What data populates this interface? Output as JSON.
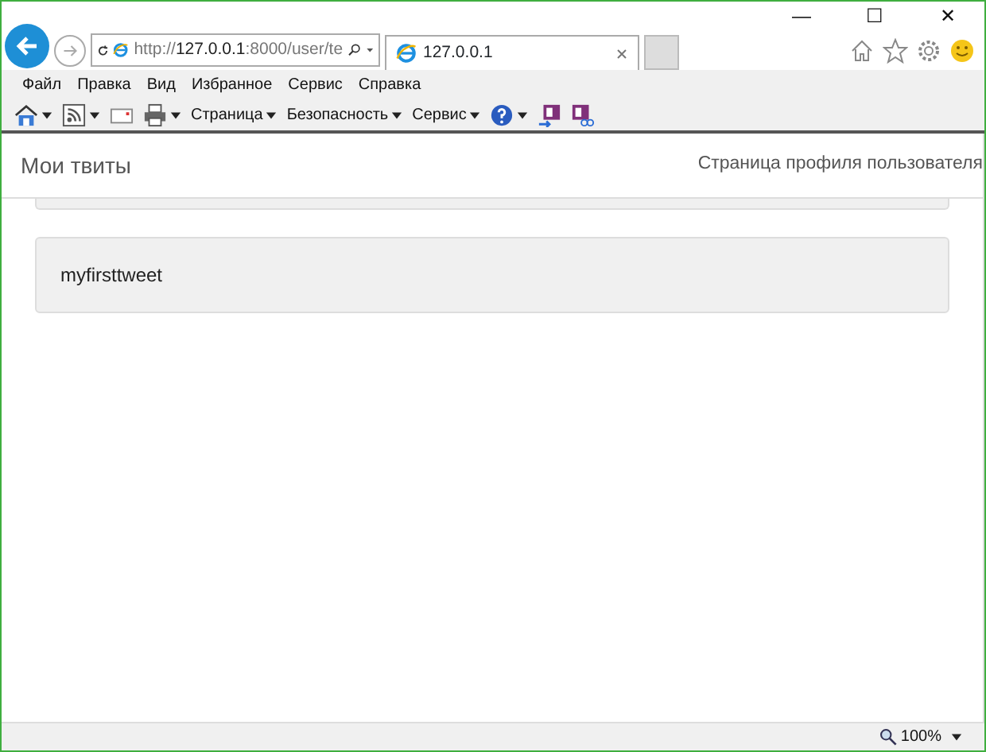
{
  "window": {
    "controls": [
      "—",
      "☐",
      "✕"
    ]
  },
  "address_bar": {
    "url": "http://**127.0.0.1**:8000/user/te"
  },
  "tabs": [
    {
      "label": "127.0.0.1",
      "selected": true
    }
  ],
  "menu_bar": [
    "Файл",
    "Правка",
    "Вид",
    "Избранное",
    "Сервис",
    "Справка"
  ],
  "command_bar": [
    {
      "kind": "icon",
      "dropdown": true
    },
    {
      "kind": "icon",
      "dropdown": true
    },
    {
      "kind": "icon",
      "dropdown": false
    },
    {
      "kind": "icon",
      "dropdown": true
    },
    {
      "kind": "text",
      "label": "Страница",
      "dropdown": true
    },
    {
      "kind": "text",
      "label": "Безопасность",
      "dropdown": true
    },
    {
      "kind": "text",
      "label": "Сервис",
      "dropdown": true
    },
    {
      "kind": "icon",
      "dropdown": true
    },
    {
      "kind": "icon",
      "dropdown": false
    },
    {
      "kind": "icon",
      "dropdown": false
    }
  ],
  "navbar": {
    "brand": "Мои твиты",
    "link": "Страница профиля пользователя"
  },
  "tweets": [
    {
      "text": "myfirsttweet"
    }
  ],
  "status_bar": {
    "zoom": "100%"
  }
}
